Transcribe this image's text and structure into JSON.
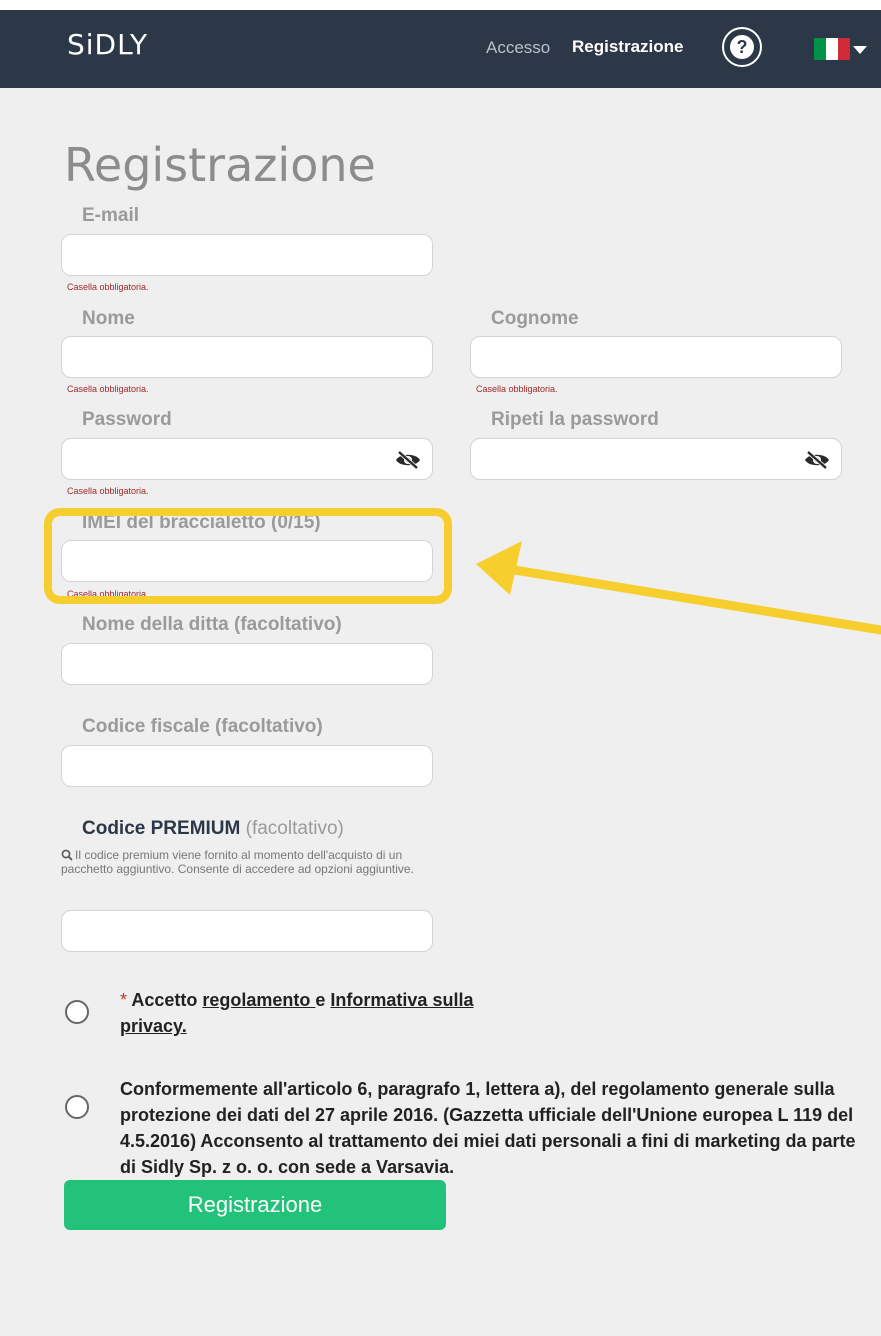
{
  "header": {
    "logo": "SiDLY",
    "nav_access": "Accesso",
    "nav_register": "Registrazione",
    "help_glyph": "?",
    "flag": {
      "colors": [
        "#009246",
        "#ffffff",
        "#ce2b37"
      ]
    }
  },
  "page_title": "Registrazione",
  "fields": {
    "email": {
      "label": "E-mail",
      "error": "Casella obbligatoria."
    },
    "nome": {
      "label": "Nome",
      "error": "Casella obbligatoria."
    },
    "cognome": {
      "label": "Cognome",
      "error": "Casella obbligatoria."
    },
    "password": {
      "label": "Password",
      "error": "Casella obbligatoria."
    },
    "repeat_password": {
      "label": "Ripeti la password"
    },
    "imei": {
      "label": "IMEI del braccialetto (0/15)",
      "error": "Casella obbligatoria."
    },
    "company": {
      "label": "Nome della ditta (facoltativo)"
    },
    "tax_code": {
      "label": "Codice fiscale (facoltativo)"
    },
    "premium": {
      "label_bold": "Codice PREMIUM",
      "label_optional": " (facoltativo)",
      "note": "Il codice premium viene fornito al momento dell'acquisto di un pacchetto aggiuntivo. Consente di accedere ad opzioni aggiuntive."
    }
  },
  "consents": {
    "terms": {
      "required_mark": "*",
      "text_before": " Accetto ",
      "link1": "regolamento ",
      "text_mid": "e ",
      "link2": "Informativa sulla privacy."
    },
    "marketing": "Conformemente all'articolo 6, paragrafo 1, lettera a), del regolamento generale sulla protezione dei dati del 27 aprile 2016. (Gazzetta ufficiale dell'Unione europea L 119 del 4.5.2016) Acconsento al trattamento dei miei dati personali a fini di marketing da parte di Sidly Sp. z o. o. con sede a Varsavia."
  },
  "submit_label": "Registrazione",
  "annotation": {
    "color": "#f6cf2e",
    "icon": "arrow-left-icon"
  },
  "colors": {
    "header_bg": "#2c3748",
    "submit": "#23c27a",
    "error": "#a0282a"
  }
}
